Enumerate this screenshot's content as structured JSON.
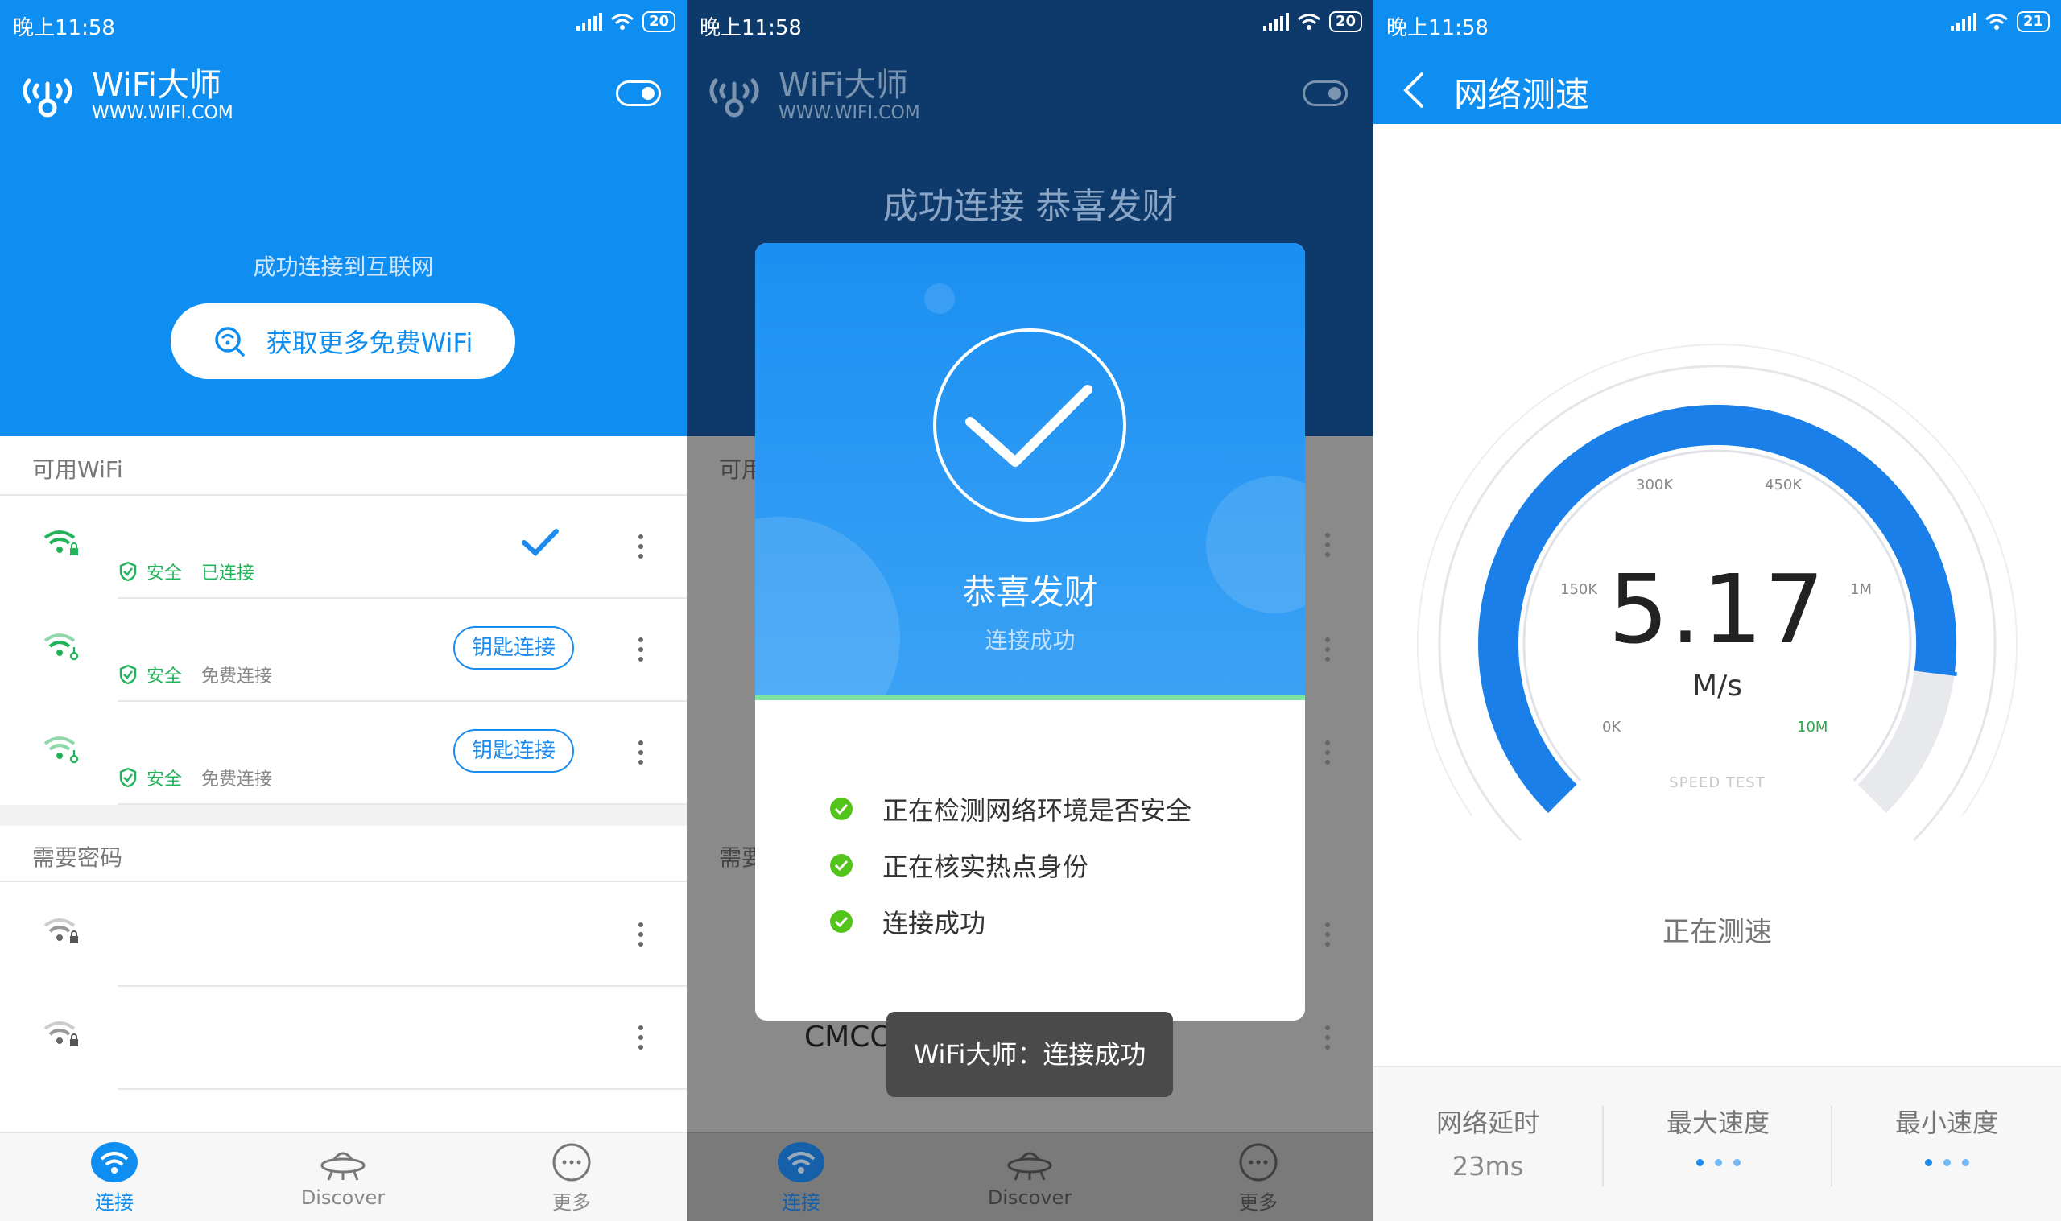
{
  "status": {
    "time": "晚上11:58",
    "battery_p1": "20",
    "battery_p2": "20",
    "battery_p3": "21"
  },
  "brand": {
    "name": "WiFi大师",
    "url": "WWW.WIFI.COM"
  },
  "panel1": {
    "connected_message": "成功连接到互联网",
    "get_more_button": "获取更多免费WiFi",
    "available_section": "可用WiFi",
    "available": [
      {
        "safe": "安全",
        "state": "已连接",
        "connected": true
      },
      {
        "safe": "安全",
        "state": "免费连接",
        "action": "钥匙连接"
      },
      {
        "safe": "安全",
        "state": "免费连接",
        "action": "钥匙连接"
      }
    ],
    "password_section": "需要密码"
  },
  "nav": {
    "connect": "连接",
    "discover": "Discover",
    "more": "更多"
  },
  "panel2": {
    "header_text": "成功连接 恭喜发财",
    "dialog_title": "恭喜发财",
    "dialog_subtitle": "连接成功",
    "steps": [
      "正在检测网络环境是否安全",
      "正在核实热点身份",
      "连接成功"
    ],
    "toast": "WiFi大师：连接成功",
    "partial_label_1": "可用",
    "partial_label_2": "需要",
    "partial_ssid": "CMCC"
  },
  "panel3": {
    "title": "网络测速",
    "speed": "5.17",
    "unit": "M/s",
    "caption": "SPEED TEST",
    "status": "正在测速",
    "ticks": [
      "0K",
      "150K",
      "300K",
      "450K",
      "1M",
      "10M"
    ],
    "progress": 0.86,
    "latency_label": "网络延时",
    "latency_value": "23ms",
    "max_label": "最大速度",
    "min_label": "最小速度"
  },
  "colors": {
    "primary": "#0f8ef1",
    "green": "#23b35a",
    "dialog_check": "#52c41a"
  }
}
